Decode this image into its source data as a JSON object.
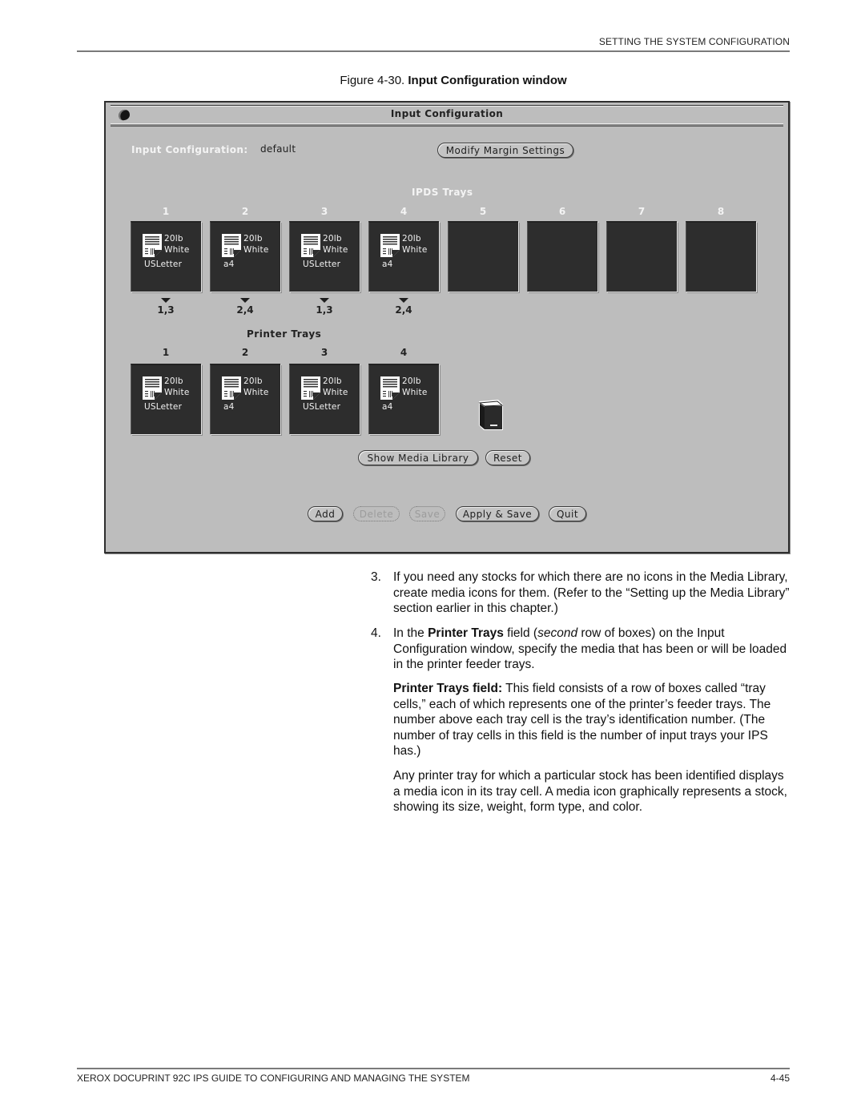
{
  "page": {
    "running_header": "SETTING THE SYSTEM CONFIGURATION",
    "figure": {
      "number": "Figure 4-30.",
      "title": "Input Configuration window"
    },
    "footer": {
      "left": "XEROX DOCUPRINT 92C IPS GUIDE TO CONFIGURING AND MANAGING THE SYSTEM",
      "right": "4-45"
    }
  },
  "window": {
    "title": "Input Configuration",
    "menu_icon": "window-menu-icon",
    "config_label": "Input Configuration:",
    "config_value": "default",
    "modify_margin_button": "Modify Margin Settings",
    "ipds_section_title": "IPDS Trays",
    "ipds_trays": [
      {
        "number": "1",
        "media": {
          "weight": "20lb",
          "color": "White",
          "size": "USLetter"
        },
        "mapping": "1,3"
      },
      {
        "number": "2",
        "media": {
          "weight": "20lb",
          "color": "White",
          "size": "a4"
        },
        "mapping": "2,4"
      },
      {
        "number": "3",
        "media": {
          "weight": "20lb",
          "color": "White",
          "size": "USLetter"
        },
        "mapping": "1,3"
      },
      {
        "number": "4",
        "media": {
          "weight": "20lb",
          "color": "White",
          "size": "a4"
        },
        "mapping": "2,4"
      },
      {
        "number": "5",
        "media": null,
        "mapping": ""
      },
      {
        "number": "6",
        "media": null,
        "mapping": ""
      },
      {
        "number": "7",
        "media": null,
        "mapping": ""
      },
      {
        "number": "8",
        "media": null,
        "mapping": ""
      }
    ],
    "printer_section_title": "Printer Trays",
    "printer_trays": [
      {
        "number": "1",
        "media": {
          "weight": "20lb",
          "color": "White",
          "size": "USLetter"
        }
      },
      {
        "number": "2",
        "media": {
          "weight": "20lb",
          "color": "White",
          "size": "a4"
        }
      },
      {
        "number": "3",
        "media": {
          "weight": "20lb",
          "color": "White",
          "size": "USLetter"
        }
      },
      {
        "number": "4",
        "media": {
          "weight": "20lb",
          "color": "White",
          "size": "a4"
        }
      }
    ],
    "trash_icon": "trash-bin-icon",
    "buttons": {
      "show_media_library": "Show Media Library",
      "reset": "Reset",
      "add": "Add",
      "delete": "Delete",
      "save": "Save",
      "apply_save": "Apply & Save",
      "quit": "Quit"
    },
    "disabled_buttons": [
      "Delete",
      "Save"
    ],
    "colors": {
      "window_bg": "#bdbdbd",
      "tray_cell_bg": "#2d2d2d",
      "light_label": "#f4f4f4"
    }
  },
  "body": {
    "step3": {
      "number": "3.",
      "text": "If you need any stocks for which there are no icons in the Media Library, create media icons for them. (Refer to the “Setting up the Media Library” section earlier in this chapter.)"
    },
    "step4": {
      "number": "4.",
      "pre": "In the ",
      "bold": "Printer Trays",
      "mid": " field (",
      "italic": "second",
      "post": " row of boxes) on the Input Configuration window, specify the media that has been or will be loaded in the printer feeder trays."
    },
    "para1": {
      "bold": "Printer Trays field:",
      "text": " This field consists of a row of boxes called “tray cells,” each of which represents one of the printer’s feeder trays. The number above each tray cell is the tray’s identification number. (The number of tray cells in this field is the number of input trays your IPS has.)"
    },
    "para2": {
      "text": "Any printer tray for which a particular stock has been identified displays a media icon in its tray cell. A media icon graphically represents a stock, showing its size, weight, form type, and color."
    }
  }
}
